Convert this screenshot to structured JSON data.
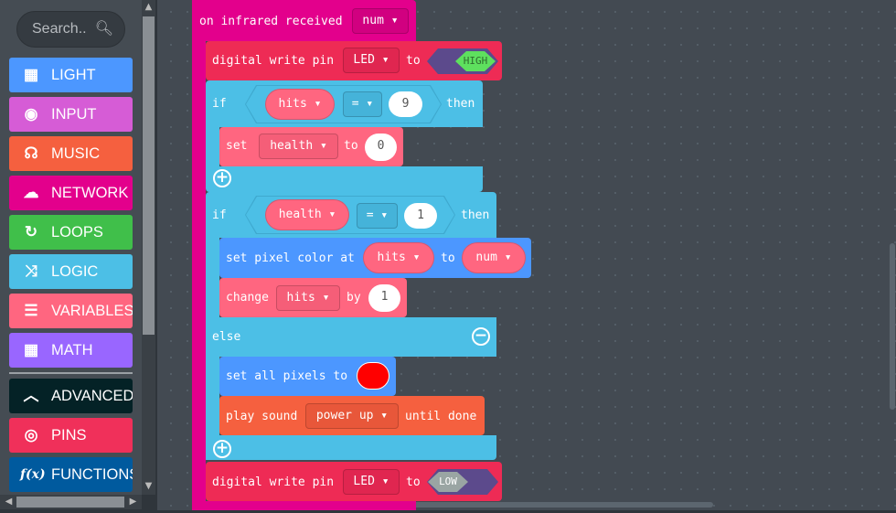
{
  "search": {
    "placeholder": "Search..",
    "icon": "search-icon"
  },
  "categories": [
    {
      "label": "LIGHT",
      "icon": "grid-icon",
      "color": "#4c97ff"
    },
    {
      "label": "INPUT",
      "icon": "target-icon",
      "color": "#d65cd6"
    },
    {
      "label": "MUSIC",
      "icon": "headphones-icon",
      "color": "#f5603f"
    },
    {
      "label": "NETWORK",
      "icon": "chat-icon",
      "color": "#e3008c"
    },
    {
      "label": "LOOPS",
      "icon": "refresh-icon",
      "color": "#40bf4a"
    },
    {
      "label": "LOGIC",
      "icon": "shuffle-icon",
      "color": "#4cbfe6"
    },
    {
      "label": "VARIABLES",
      "icon": "list-icon",
      "color": "#ff6680"
    },
    {
      "label": "MATH",
      "icon": "calculator-icon",
      "color": "#9966ff"
    },
    {
      "label": "ADVANCED",
      "icon": "chevron-up-icon",
      "color": "#042226"
    },
    {
      "label": "PINS",
      "icon": "rings-icon",
      "color": "#f0305a"
    },
    {
      "label": "FUNCTIONS",
      "icon": "function-icon",
      "color": "#005a9e"
    }
  ],
  "blocks": {
    "event": {
      "label": "on infrared received",
      "var": "num ▾"
    },
    "write1": {
      "label": "digital write pin",
      "pin": "LED ▾",
      "to": "to",
      "value": "HIGH"
    },
    "if1": {
      "if": "if",
      "var": "hits ▾",
      "op": "= ▾",
      "num": "9",
      "then": "then"
    },
    "set1": {
      "label": "set",
      "var": "health ▾",
      "to": "to",
      "value": "0"
    },
    "if2": {
      "if": "if",
      "var": "health ▾",
      "op": "= ▾",
      "num": "1",
      "then": "then",
      "else": "else"
    },
    "pixel": {
      "label": "set pixel color at",
      "var": "hits ▾",
      "to": "to",
      "value": "num ▾"
    },
    "change": {
      "label": "change",
      "var": "hits ▾",
      "by": "by",
      "value": "1"
    },
    "allpix": {
      "label": "set all pixels to",
      "color": "#ff0000"
    },
    "sound": {
      "label": "play sound",
      "sound": "power up ▾",
      "suffix": "until done"
    },
    "write2": {
      "label": "digital write pin",
      "pin": "LED ▾",
      "to": "to",
      "value": "LOW"
    }
  }
}
